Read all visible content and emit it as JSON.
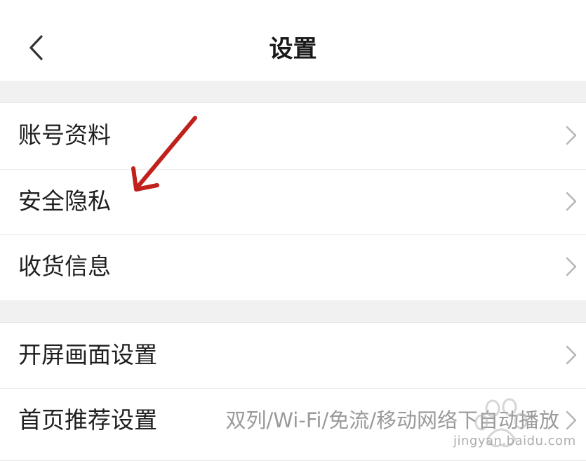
{
  "header": {
    "title": "设置",
    "back_icon": "chevron-left-icon"
  },
  "groups": [
    {
      "items": [
        {
          "label": "账号资料",
          "value": ""
        },
        {
          "label": "安全隐私",
          "value": ""
        },
        {
          "label": "收货信息",
          "value": ""
        }
      ]
    },
    {
      "items": [
        {
          "label": "开屏画面设置",
          "value": ""
        },
        {
          "label": "首页推荐设置",
          "value": "双列/Wi-Fi/免流/移动网络下自动播放"
        }
      ]
    }
  ],
  "annotation": {
    "icon": "red-arrow-icon",
    "color": "#c0211c"
  },
  "watermark": {
    "text": "jingyan.baidu.com",
    "icon": "baidu-paw-icon"
  },
  "colors": {
    "background": "#ffffff",
    "section_gap": "#f1f1f1",
    "divider": "#ececec",
    "text_primary": "#1f1f1f",
    "text_secondary": "#9a9a9a",
    "chevron": "#b5b5b5"
  }
}
